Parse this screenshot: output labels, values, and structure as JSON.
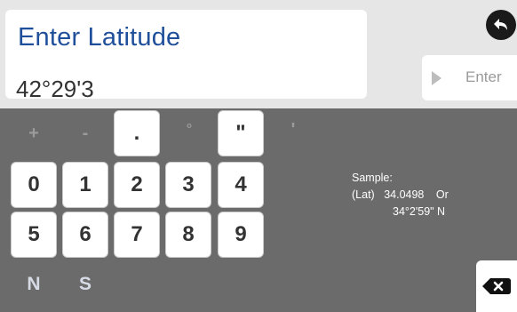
{
  "header": {
    "title": "Enter Latitude",
    "value": "42°29'3"
  },
  "buttons": {
    "enter_label": "Enter"
  },
  "symbols": [
    "+",
    "-",
    ".",
    "°",
    "\"",
    "'"
  ],
  "digits_row1": [
    "0",
    "1",
    "2",
    "3",
    "4"
  ],
  "digits_row2": [
    "5",
    "6",
    "7",
    "8",
    "9"
  ],
  "hemisphere": [
    "N",
    "S"
  ],
  "sample": {
    "heading": "Sample:",
    "prefix": "(Lat)",
    "decimal": "34.0498",
    "or": "Or",
    "dms": "34°2'59\" N"
  },
  "icons": {
    "back": "back-arrow-icon",
    "enter": "play-triangle-icon",
    "delete": "backspace-icon"
  },
  "colors": {
    "title": "#1f4f9a",
    "keypad_bg": "#6b6b6b",
    "top_bg": "#e6e6e6"
  }
}
